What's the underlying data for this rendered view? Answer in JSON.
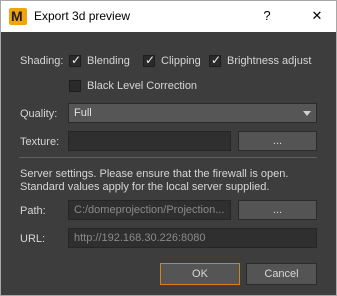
{
  "window": {
    "title": "Export 3d preview",
    "help_glyph": "?",
    "close_glyph": "✕",
    "app_icon": "m-logo-icon"
  },
  "shading": {
    "label": "Shading:",
    "options": [
      {
        "label": "Blending",
        "checked": true
      },
      {
        "label": "Clipping",
        "checked": true
      },
      {
        "label": "Brightness adjust",
        "checked": true
      },
      {
        "label": "Black Level Correction",
        "checked": false
      }
    ]
  },
  "quality": {
    "label": "Quality:",
    "value": "Full"
  },
  "texture": {
    "label": "Texture:",
    "value": "",
    "browse_label": "..."
  },
  "server": {
    "description_line1": "Server settings. Please ensure that the firewall is open.",
    "description_line2": "Standard values apply for the local server supplied.",
    "path_label": "Path:",
    "path_value": "C:/domeprojection/Projection...",
    "path_browse_label": "...",
    "url_label": "URL:",
    "url_value": "http://192.168.30.226:8080"
  },
  "actions": {
    "ok_label": "OK",
    "cancel_label": "Cancel"
  }
}
